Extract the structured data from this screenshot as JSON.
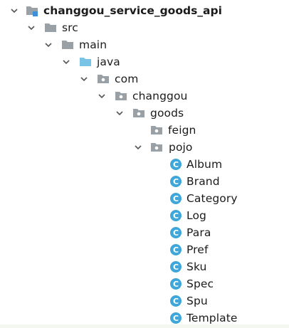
{
  "project_tree": {
    "root": {
      "label": "changgou_service_goods_api"
    },
    "src": {
      "label": "src"
    },
    "main": {
      "label": "main"
    },
    "java": {
      "label": "java"
    },
    "com": {
      "label": "com"
    },
    "changgou": {
      "label": "changgou"
    },
    "goods": {
      "label": "goods"
    },
    "feign": {
      "label": "feign"
    },
    "pojo": {
      "label": "pojo"
    },
    "classes": [
      {
        "label": "Album",
        "icon_letter": "C"
      },
      {
        "label": "Brand",
        "icon_letter": "C"
      },
      {
        "label": "Category",
        "icon_letter": "C"
      },
      {
        "label": "Log",
        "icon_letter": "C"
      },
      {
        "label": "Para",
        "icon_letter": "C"
      },
      {
        "label": "Pref",
        "icon_letter": "C"
      },
      {
        "label": "Sku",
        "icon_letter": "C"
      },
      {
        "label": "Spec",
        "icon_letter": "C"
      },
      {
        "label": "Spu",
        "icon_letter": "C"
      },
      {
        "label": "Template",
        "icon_letter": "C"
      }
    ]
  },
  "colors": {
    "folder": "#9aa1a6",
    "source_folder": "#79c4e6",
    "module_badge": "#3c8fd9",
    "class_icon_fill": "#3ea7d8",
    "arrow": "#555555",
    "text": "#1b1b1b"
  },
  "icons": {
    "expanded_arrow": "chevron-down-icon",
    "module": "module-folder-icon",
    "folder": "folder-icon",
    "source_folder": "source-folder-icon",
    "package": "package-icon",
    "class": "class-icon"
  }
}
